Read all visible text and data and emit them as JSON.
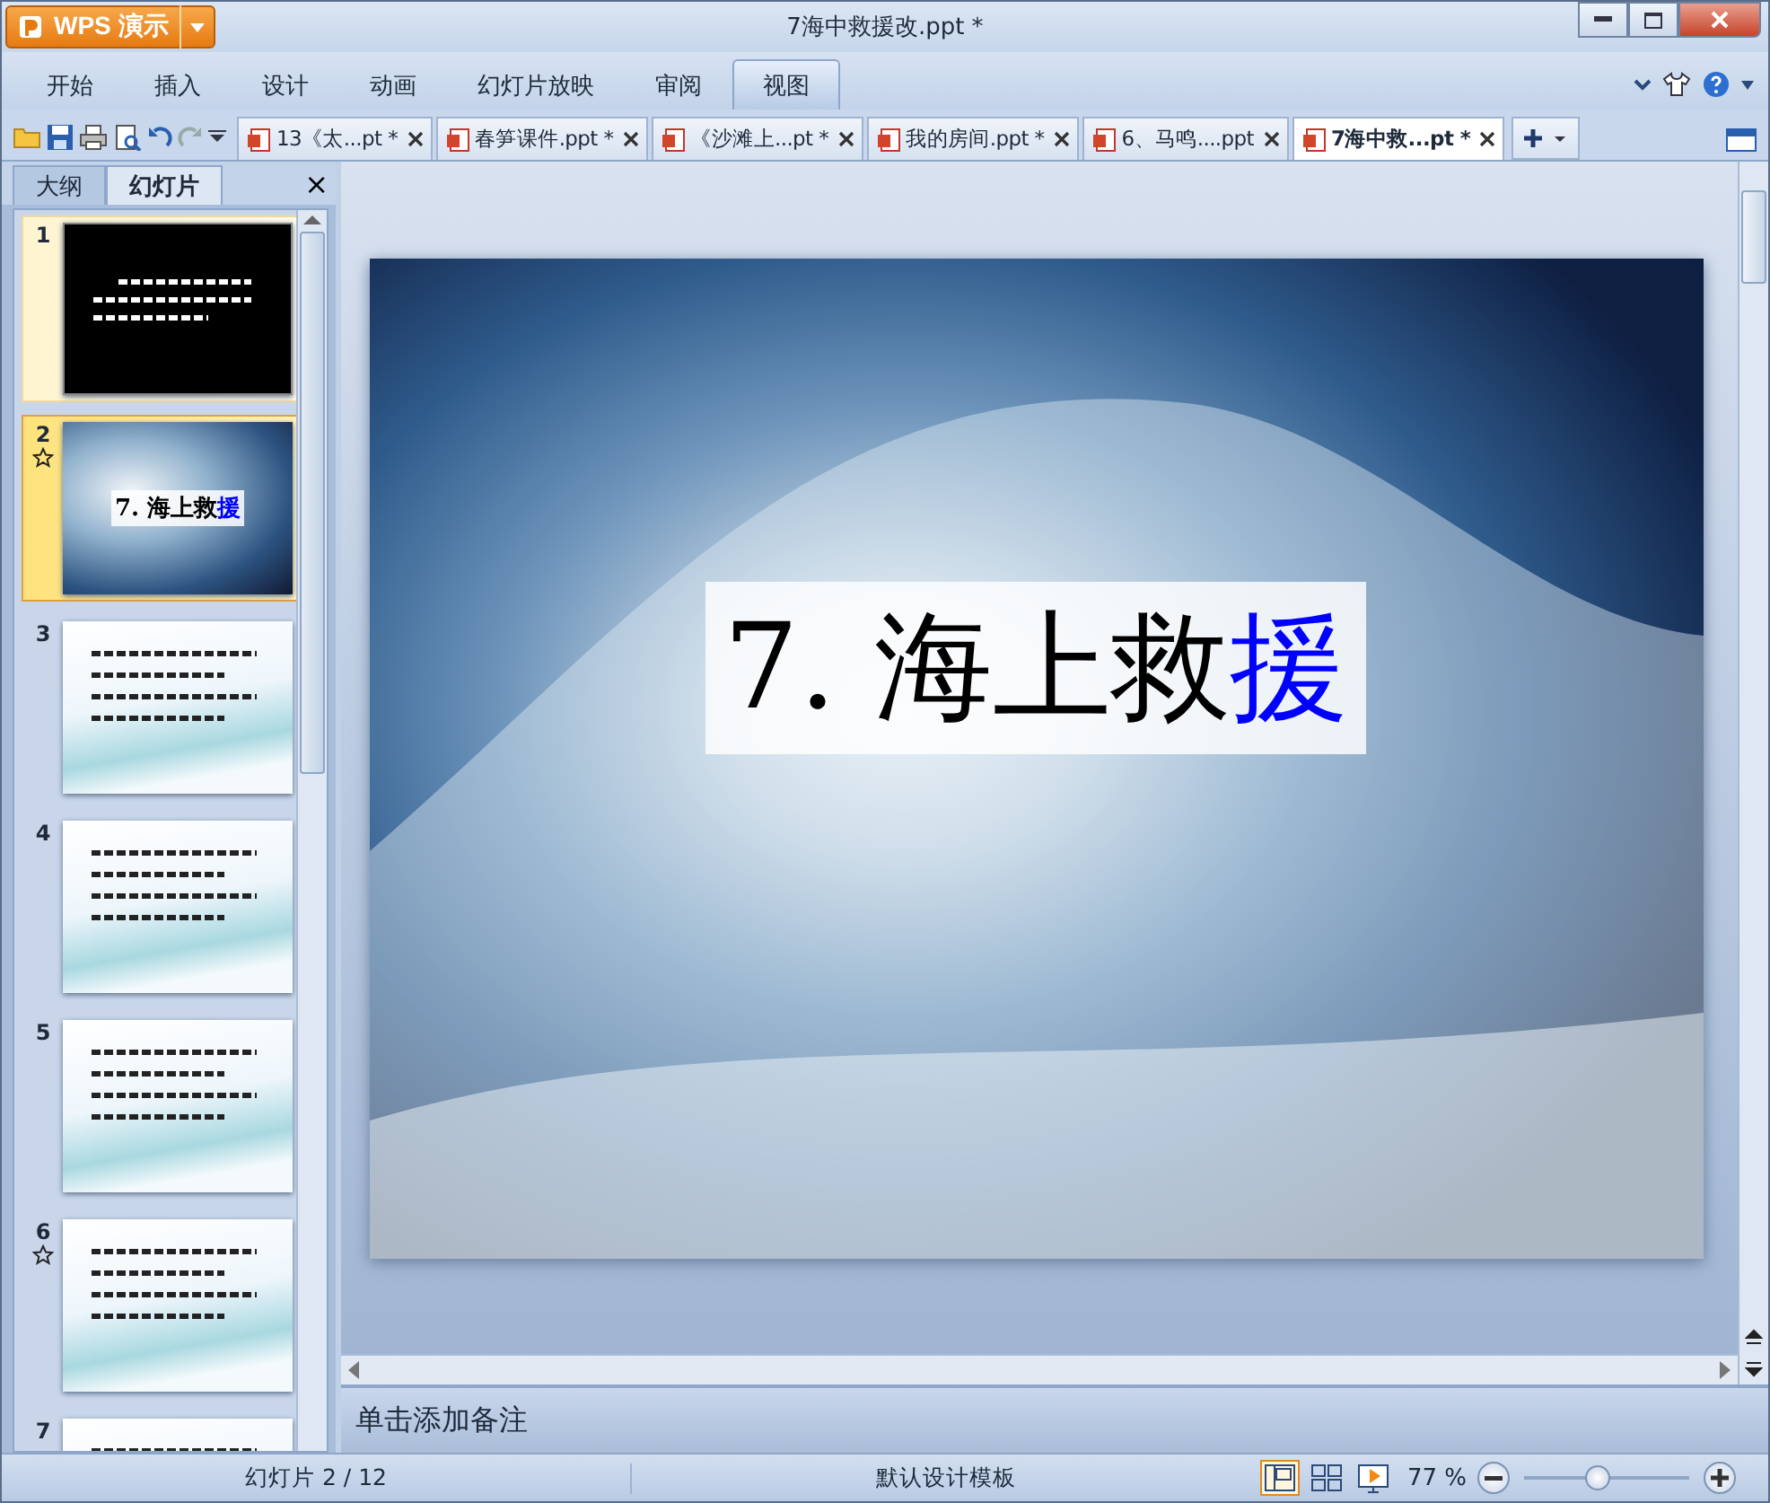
{
  "app_button": {
    "label": "WPS 演示"
  },
  "window": {
    "title": "7海中救援改.ppt *"
  },
  "ribbon_tabs": [
    {
      "label": "开始",
      "selected": false
    },
    {
      "label": "插入",
      "selected": false
    },
    {
      "label": "设计",
      "selected": false
    },
    {
      "label": "动画",
      "selected": false
    },
    {
      "label": "幻灯片放映",
      "selected": false
    },
    {
      "label": "审阅",
      "selected": false
    },
    {
      "label": "视图",
      "selected": true
    }
  ],
  "doc_tabs": [
    {
      "label": "13《太...pt *",
      "selected": false
    },
    {
      "label": "春笋课件.ppt *",
      "selected": false
    },
    {
      "label": "《沙滩上...pt *",
      "selected": false
    },
    {
      "label": "我的房间.ppt *",
      "selected": false
    },
    {
      "label": "6、马鸣....ppt",
      "selected": false
    },
    {
      "label": "7海中救...pt *",
      "selected": true
    }
  ],
  "panel_tabs": [
    {
      "label": "大纲",
      "selected": false
    },
    {
      "label": "幻灯片",
      "selected": true
    }
  ],
  "panel_close": "×",
  "slides": [
    {
      "number": "1",
      "kind": "dark",
      "starred": false,
      "selected": false
    },
    {
      "number": "2",
      "kind": "title",
      "starred": true,
      "selected": true,
      "title": [
        {
          "text": "7. 海上救",
          "color": "#000000"
        },
        {
          "text": "援",
          "color": "#0000ff"
        }
      ]
    },
    {
      "number": "3",
      "kind": "sky",
      "starred": false,
      "selected": false
    },
    {
      "number": "4",
      "kind": "sky",
      "starred": false,
      "selected": false
    },
    {
      "number": "5",
      "kind": "sky",
      "starred": false,
      "selected": false
    },
    {
      "number": "6",
      "kind": "sky",
      "starred": true,
      "selected": false
    },
    {
      "number": "7",
      "kind": "sky",
      "starred": false,
      "selected": false
    }
  ],
  "slide_title": [
    {
      "text": "7. 海上救",
      "color": "#000000"
    },
    {
      "text": "援",
      "color": "#0000ff"
    }
  ],
  "notes": {
    "placeholder": "单击添加备注"
  },
  "status_bar": {
    "slide_info": "幻灯片 2 / 12",
    "template": "默认设计模板",
    "zoom": "77 %",
    "zoom_slider": {
      "level": 0.45
    },
    "views": [
      {
        "selected": true
      },
      {
        "selected": false
      },
      {
        "selected": false
      }
    ]
  }
}
